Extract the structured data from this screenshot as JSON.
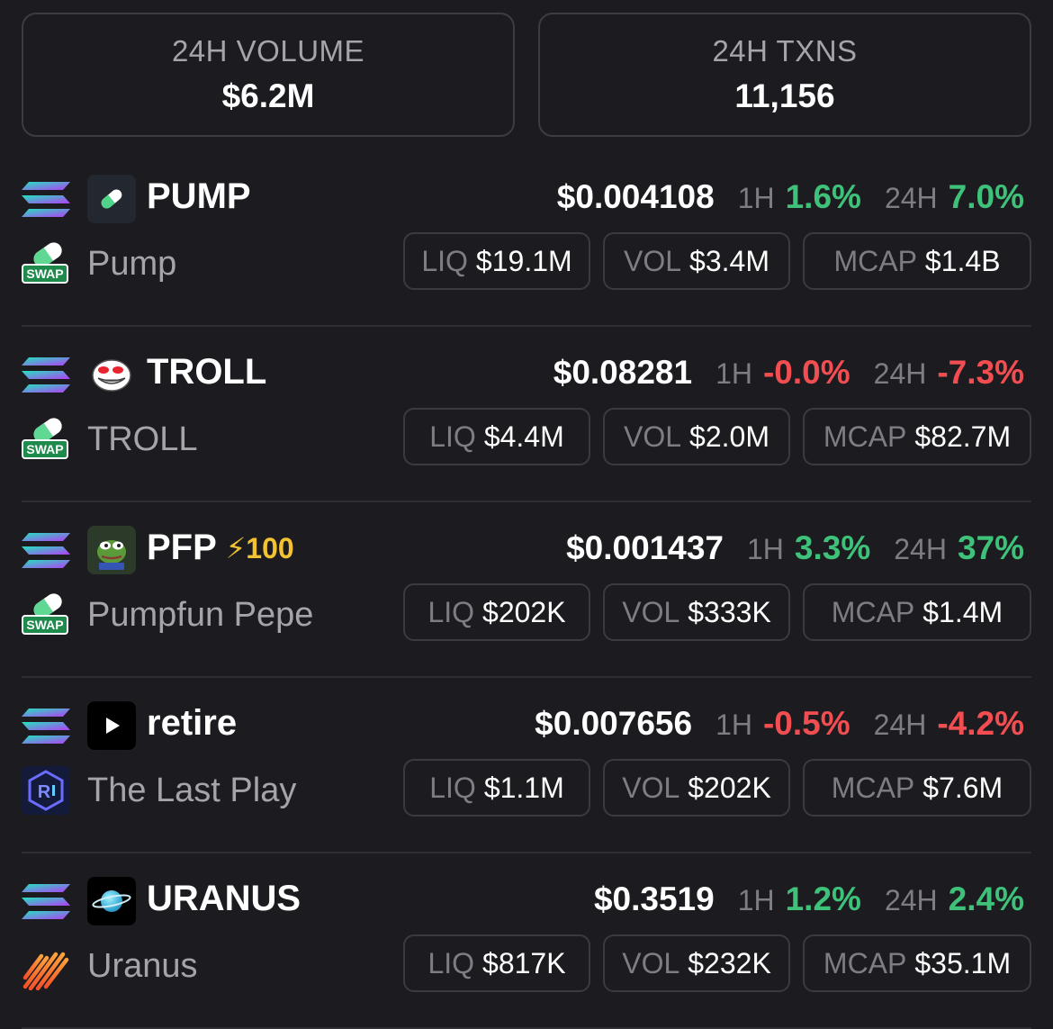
{
  "stats": {
    "volume": {
      "label": "24H VOLUME",
      "value": "$6.2M"
    },
    "txns": {
      "label": "24H TXNS",
      "value": "11,156"
    }
  },
  "labels": {
    "h1": "1H",
    "h24": "24H",
    "liq": "LIQ",
    "vol": "VOL",
    "mcap": "MCAP"
  },
  "colors": {
    "positive": "#3ec27a",
    "negative": "#f24e52",
    "boost": "#f3c230"
  },
  "tokens": [
    {
      "symbol": "PUMP",
      "name": "Pump",
      "price": "$0.004108",
      "change_1h": "1.6%",
      "change_24h": "7.0%",
      "liq": "$19.1M",
      "vol": "$3.4M",
      "mcap": "$1.4B",
      "token_icon": "pill-icon",
      "dex_icon": "pumpswap-icon",
      "chain_icon": "solana-icon"
    },
    {
      "symbol": "TROLL",
      "name": "TROLL",
      "price": "$0.08281",
      "change_1h": "-0.0%",
      "change_24h": "-7.3%",
      "liq": "$4.4M",
      "vol": "$2.0M",
      "mcap": "$82.7M",
      "token_icon": "trollface-icon",
      "dex_icon": "pumpswap-icon",
      "chain_icon": "solana-icon"
    },
    {
      "symbol": "PFP",
      "boost": "⚡100",
      "name": "Pumpfun Pepe",
      "price": "$0.001437",
      "change_1h": "3.3%",
      "change_24h": "37%",
      "liq": "$202K",
      "vol": "$333K",
      "mcap": "$1.4M",
      "token_icon": "pepe-icon",
      "dex_icon": "pumpswap-icon",
      "chain_icon": "solana-icon"
    },
    {
      "symbol": "retire",
      "name": "The Last Play",
      "price": "$0.007656",
      "change_1h": "-0.5%",
      "change_24h": "-4.2%",
      "liq": "$1.1M",
      "vol": "$202K",
      "mcap": "$7.6M",
      "token_icon": "play-icon",
      "dex_icon": "raydium-icon",
      "chain_icon": "solana-icon"
    },
    {
      "symbol": "URANUS",
      "name": "Uranus",
      "price": "$0.3519",
      "change_1h": "1.2%",
      "change_24h": "2.4%",
      "liq": "$817K",
      "vol": "$232K",
      "mcap": "$35.1M",
      "token_icon": "planet-icon",
      "dex_icon": "meteora-icon",
      "chain_icon": "solana-icon"
    }
  ]
}
